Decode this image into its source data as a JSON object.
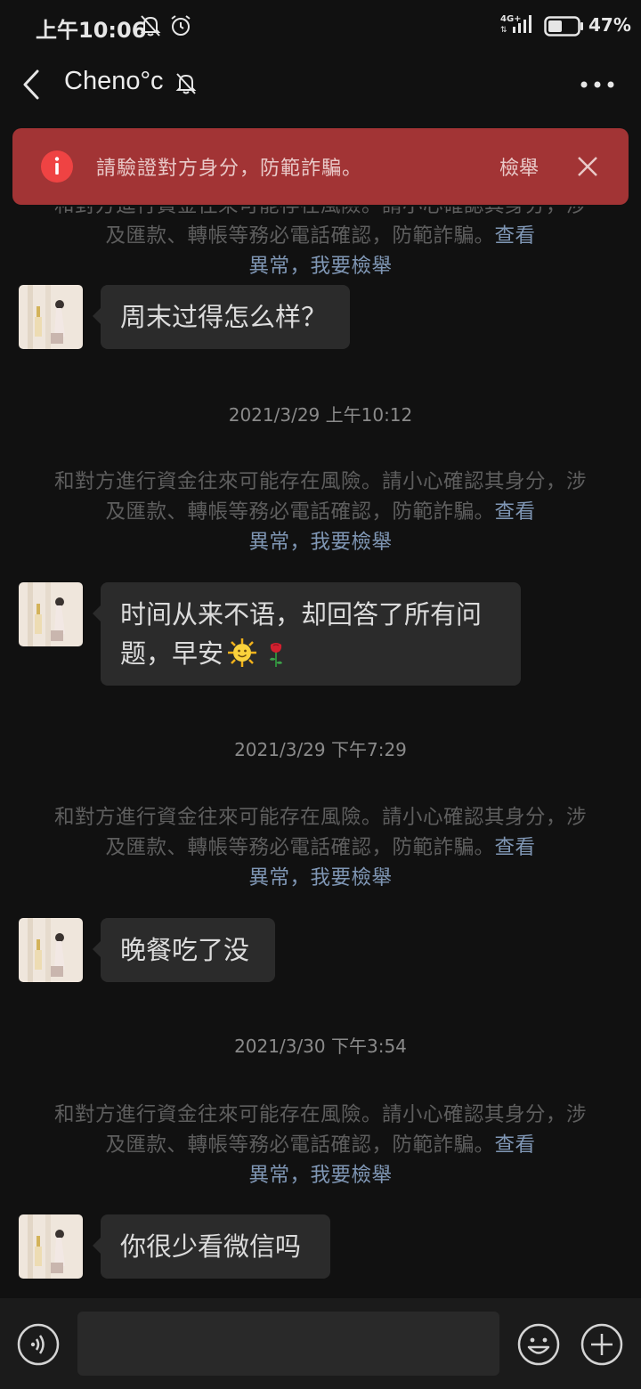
{
  "status_bar": {
    "time": "上午10:06",
    "network": "4G+",
    "battery": "47%"
  },
  "header": {
    "contact_name": "Cheno°c",
    "icons": [
      "back-icon",
      "mute-bell-icon",
      "more-icon"
    ]
  },
  "warning": {
    "text": "請驗證對方身分，防範詐騙。",
    "report_label": "檢舉",
    "accent": "#a23435"
  },
  "notice": {
    "text": "和對方進行資金往來可能存在風險。請小心確認其身分，涉及匯款、轉帳等務必電話確認，防範詐騙。",
    "link_view": "查看",
    "link_report": "異常，我要檢舉"
  },
  "messages": [
    {
      "type": "incoming",
      "text": "周末过得怎么样？"
    },
    {
      "type": "timestamp",
      "text": "2021/3/29 上午10:12"
    },
    {
      "type": "notice"
    },
    {
      "type": "incoming",
      "text": "时间从来不语，却回答了所有问题，早安",
      "emoji": [
        "sun-face-emoji",
        "rose-emoji"
      ]
    },
    {
      "type": "timestamp",
      "text": "2021/3/29 下午7:29"
    },
    {
      "type": "notice"
    },
    {
      "type": "incoming",
      "text": "晚餐吃了没"
    },
    {
      "type": "timestamp",
      "text": "2021/3/30 下午3:54"
    },
    {
      "type": "notice"
    },
    {
      "type": "incoming",
      "text": "你很少看微信吗"
    }
  ],
  "input_bar": {
    "icons": [
      "voice-icon",
      "emoji-icon",
      "plus-icon"
    ]
  }
}
